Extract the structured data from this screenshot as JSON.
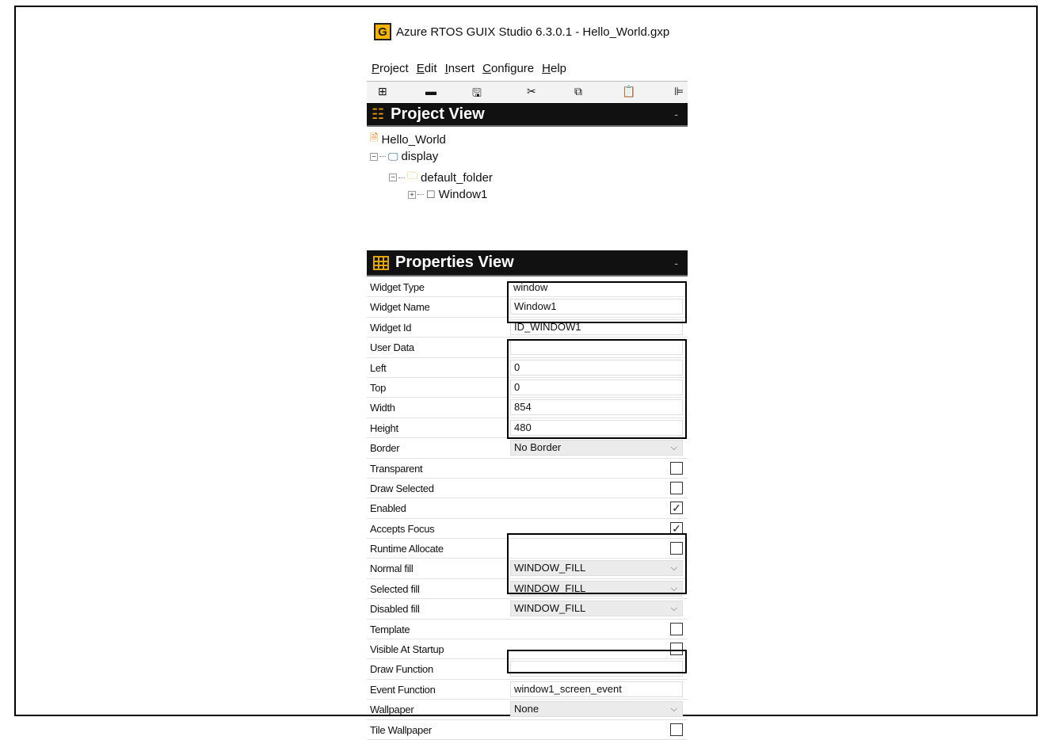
{
  "window": {
    "title": "Azure RTOS GUIX Studio 6.3.0.1 - Hello_World.gxp",
    "logo": "G"
  },
  "menu": [
    {
      "label": "Project"
    },
    {
      "label": "Edit"
    },
    {
      "label": "Insert"
    },
    {
      "label": "Configure"
    },
    {
      "label": "Help"
    }
  ],
  "toolbar": {
    "icons": [
      "new-icon",
      "open-folder-icon",
      "save-icon",
      "cut-icon",
      "copy-icon",
      "paste-icon",
      "align-left-icon"
    ],
    "glyphs": [
      "⊞",
      "▬",
      "🖫",
      "✂",
      "⧉",
      "📋",
      "⊫"
    ]
  },
  "project_view": {
    "title": "Project View",
    "minimize": "-",
    "tree": [
      {
        "label": "Hello_World"
      },
      {
        "label": "display"
      },
      {
        "label": "default_folder"
      },
      {
        "label": "Window1"
      }
    ]
  },
  "properties_view": {
    "title": "Properties View",
    "minimize": "-",
    "rows": {
      "widget_type": {
        "label": "Widget Type",
        "value": "window"
      },
      "widget_name": {
        "label": "Widget Name",
        "value": "Window1"
      },
      "widget_id": {
        "label": "Widget Id",
        "value": "ID_WINDOW1"
      },
      "user_data": {
        "label": "User Data",
        "value": ""
      },
      "left": {
        "label": "Left",
        "value": "0"
      },
      "top": {
        "label": "Top",
        "value": "0"
      },
      "width": {
        "label": "Width",
        "value": "854"
      },
      "height": {
        "label": "Height",
        "value": "480"
      },
      "border": {
        "label": "Border",
        "value": "No Border"
      },
      "transparent": {
        "label": "Transparent",
        "checked": false
      },
      "draw_selected": {
        "label": "Draw Selected",
        "checked": false
      },
      "enabled": {
        "label": "Enabled",
        "checked": true
      },
      "accepts_focus": {
        "label": "Accepts Focus",
        "checked": true
      },
      "runtime_allocate": {
        "label": "Runtime Allocate",
        "checked": false
      },
      "normal_fill": {
        "label": "Normal fill",
        "value": "WINDOW_FILL"
      },
      "selected_fill": {
        "label": "Selected fill",
        "value": "WINDOW_FILL"
      },
      "disabled_fill": {
        "label": "Disabled fill",
        "value": "WINDOW_FILL"
      },
      "template": {
        "label": "Template",
        "checked": false
      },
      "visible_at_startup": {
        "label": "Visible At Startup",
        "checked": false
      },
      "draw_function": {
        "label": "Draw Function",
        "value": ""
      },
      "event_function": {
        "label": "Event Function",
        "value": "window1_screen_event"
      },
      "wallpaper": {
        "label": "Wallpaper",
        "value": "None"
      },
      "tile_wallpaper": {
        "label": "Tile Wallpaper",
        "checked": false
      }
    },
    "check_glyph": "✓",
    "chevron_glyph": "⌵"
  }
}
